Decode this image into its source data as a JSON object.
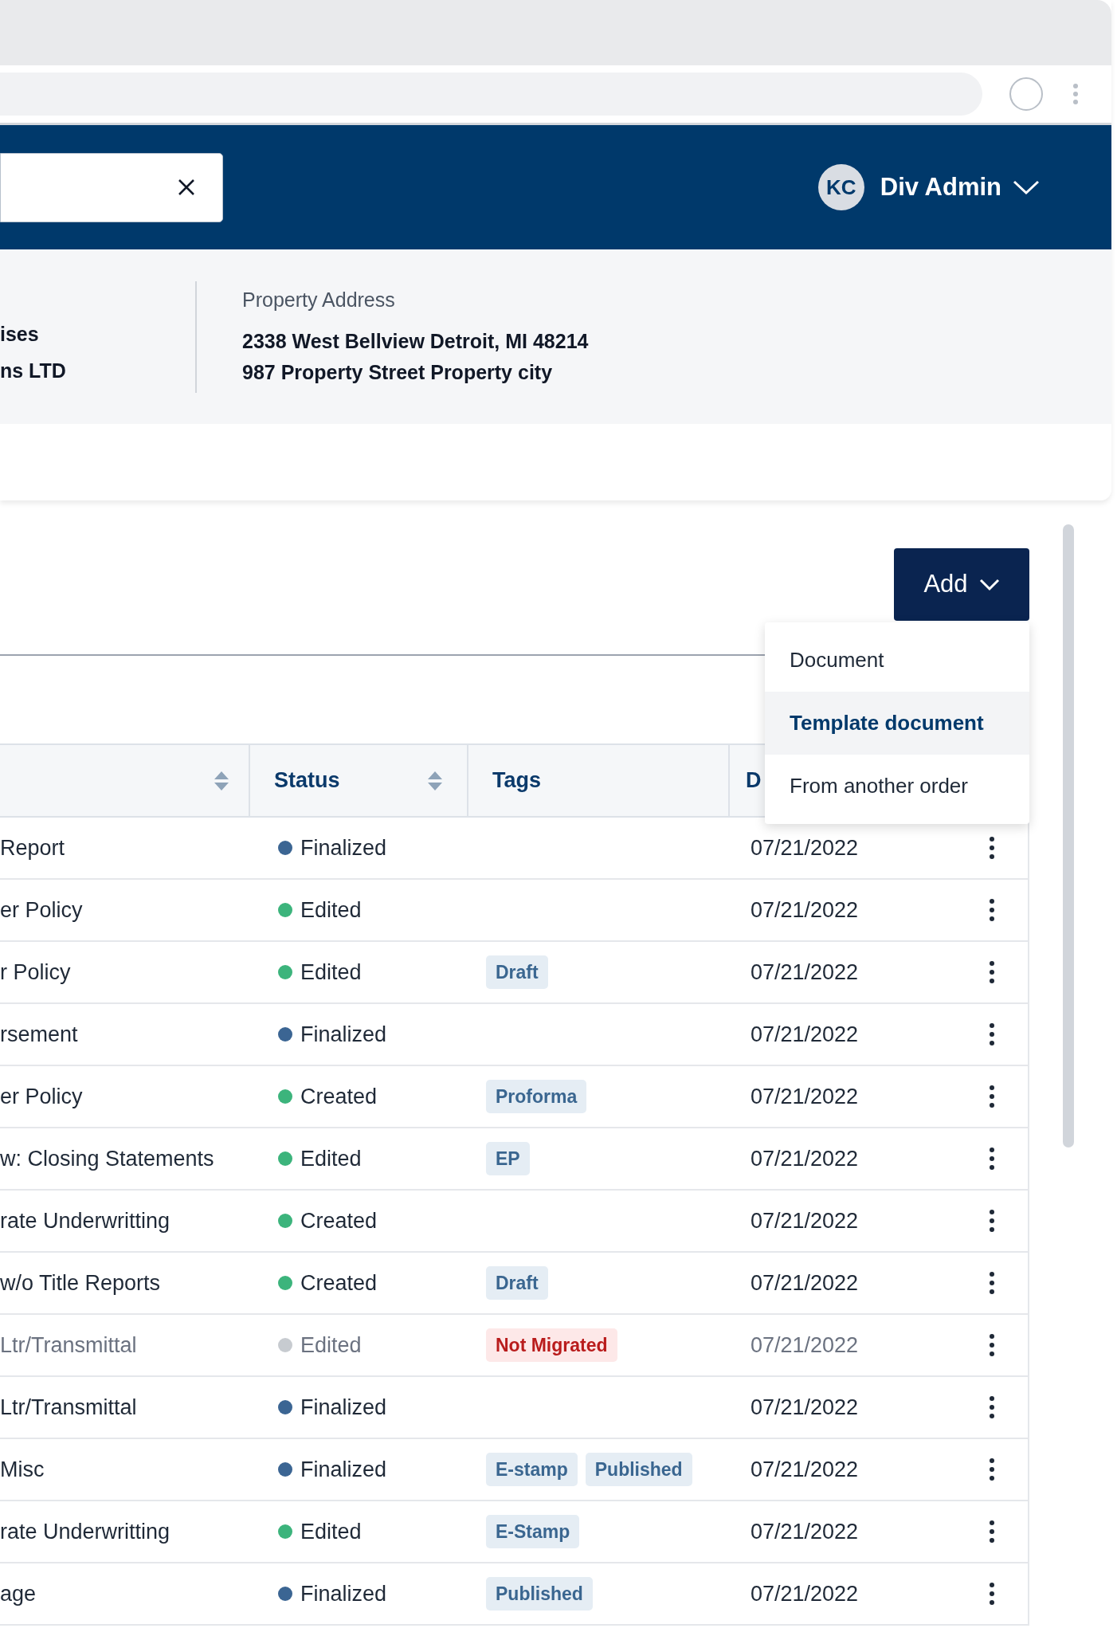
{
  "user": {
    "initials": "KC",
    "name": "Div Admin"
  },
  "order_info": {
    "parties": [
      "ises",
      "ns LTD"
    ],
    "property_address": {
      "label": "Property Address",
      "lines": [
        "2338 West Bellview Detroit, MI 48214",
        "987 Property Street Property city"
      ]
    }
  },
  "add_menu": {
    "button": "Add",
    "expanded": true,
    "items": [
      {
        "label": "Document",
        "selected": false
      },
      {
        "label": "Template document",
        "selected": true
      },
      {
        "label": "From another order",
        "selected": false
      }
    ]
  },
  "table": {
    "columns": [
      {
        "sortable": true
      },
      {
        "label": "Status",
        "sortable": true
      },
      {
        "label": "Tags",
        "sortable": false
      },
      {
        "label": "D",
        "sortable": false
      }
    ],
    "rows": [
      {
        "name": "Report",
        "status": {
          "label": "Finalized",
          "color": "#3b6593"
        },
        "date": "07/21/2022",
        "disabled": false
      },
      {
        "name": "er Policy",
        "status": {
          "label": "Edited",
          "color": "#3cb47c"
        },
        "date": "07/21/2022",
        "disabled": false
      },
      {
        "name": "r Policy",
        "status": {
          "label": "Edited",
          "color": "#3cb47c"
        },
        "tags": [
          {
            "label": "Draft",
            "kind": "info"
          }
        ],
        "date": "07/21/2022",
        "disabled": false
      },
      {
        "name": "rsement",
        "status": {
          "label": "Finalized",
          "color": "#3b6593"
        },
        "date": "07/21/2022",
        "disabled": false
      },
      {
        "name": "er Policy",
        "status": {
          "label": "Created",
          "color": "#3cb47c"
        },
        "tags": [
          {
            "label": "Proforma",
            "kind": "info"
          }
        ],
        "date": "07/21/2022",
        "disabled": false
      },
      {
        "name": "w: Closing Statements",
        "status": {
          "label": "Edited",
          "color": "#3cb47c"
        },
        "tags": [
          {
            "label": "EP",
            "kind": "info"
          }
        ],
        "date": "07/21/2022",
        "disabled": false
      },
      {
        "name": "rate Underwritting",
        "status": {
          "label": "Created",
          "color": "#3cb47c"
        },
        "date": "07/21/2022",
        "disabled": false
      },
      {
        "name": "w/o Title Reports",
        "status": {
          "label": "Created",
          "color": "#3cb47c"
        },
        "tags": [
          {
            "label": "Draft",
            "kind": "info"
          }
        ],
        "date": "07/21/2022",
        "disabled": false
      },
      {
        "name": "Ltr/Transmittal",
        "status": {
          "label": "Edited",
          "color": "#c7cbd0"
        },
        "tags": [
          {
            "label": "Not Migrated",
            "kind": "warning"
          }
        ],
        "date": "07/21/2022",
        "disabled": true
      },
      {
        "name": "Ltr/Transmittal",
        "status": {
          "label": "Finalized",
          "color": "#3b6593"
        },
        "date": "07/21/2022",
        "disabled": false
      },
      {
        "name": "Misc",
        "status": {
          "label": "Finalized",
          "color": "#3b6593"
        },
        "tags": [
          {
            "label": "E-stamp",
            "kind": "info"
          },
          {
            "label": "Published",
            "kind": "info"
          }
        ],
        "date": "07/21/2022",
        "disabled": false
      },
      {
        "name": "rate Underwritting",
        "status": {
          "label": "Edited",
          "color": "#3cb47c"
        },
        "tags": [
          {
            "label": "E-Stamp",
            "kind": "info"
          }
        ],
        "date": "07/21/2022",
        "disabled": false
      },
      {
        "name": "age",
        "status": {
          "label": "Finalized",
          "color": "#3b6593"
        },
        "tags": [
          {
            "label": "Published",
            "kind": "info"
          }
        ],
        "date": "07/21/2022",
        "disabled": false
      }
    ]
  }
}
